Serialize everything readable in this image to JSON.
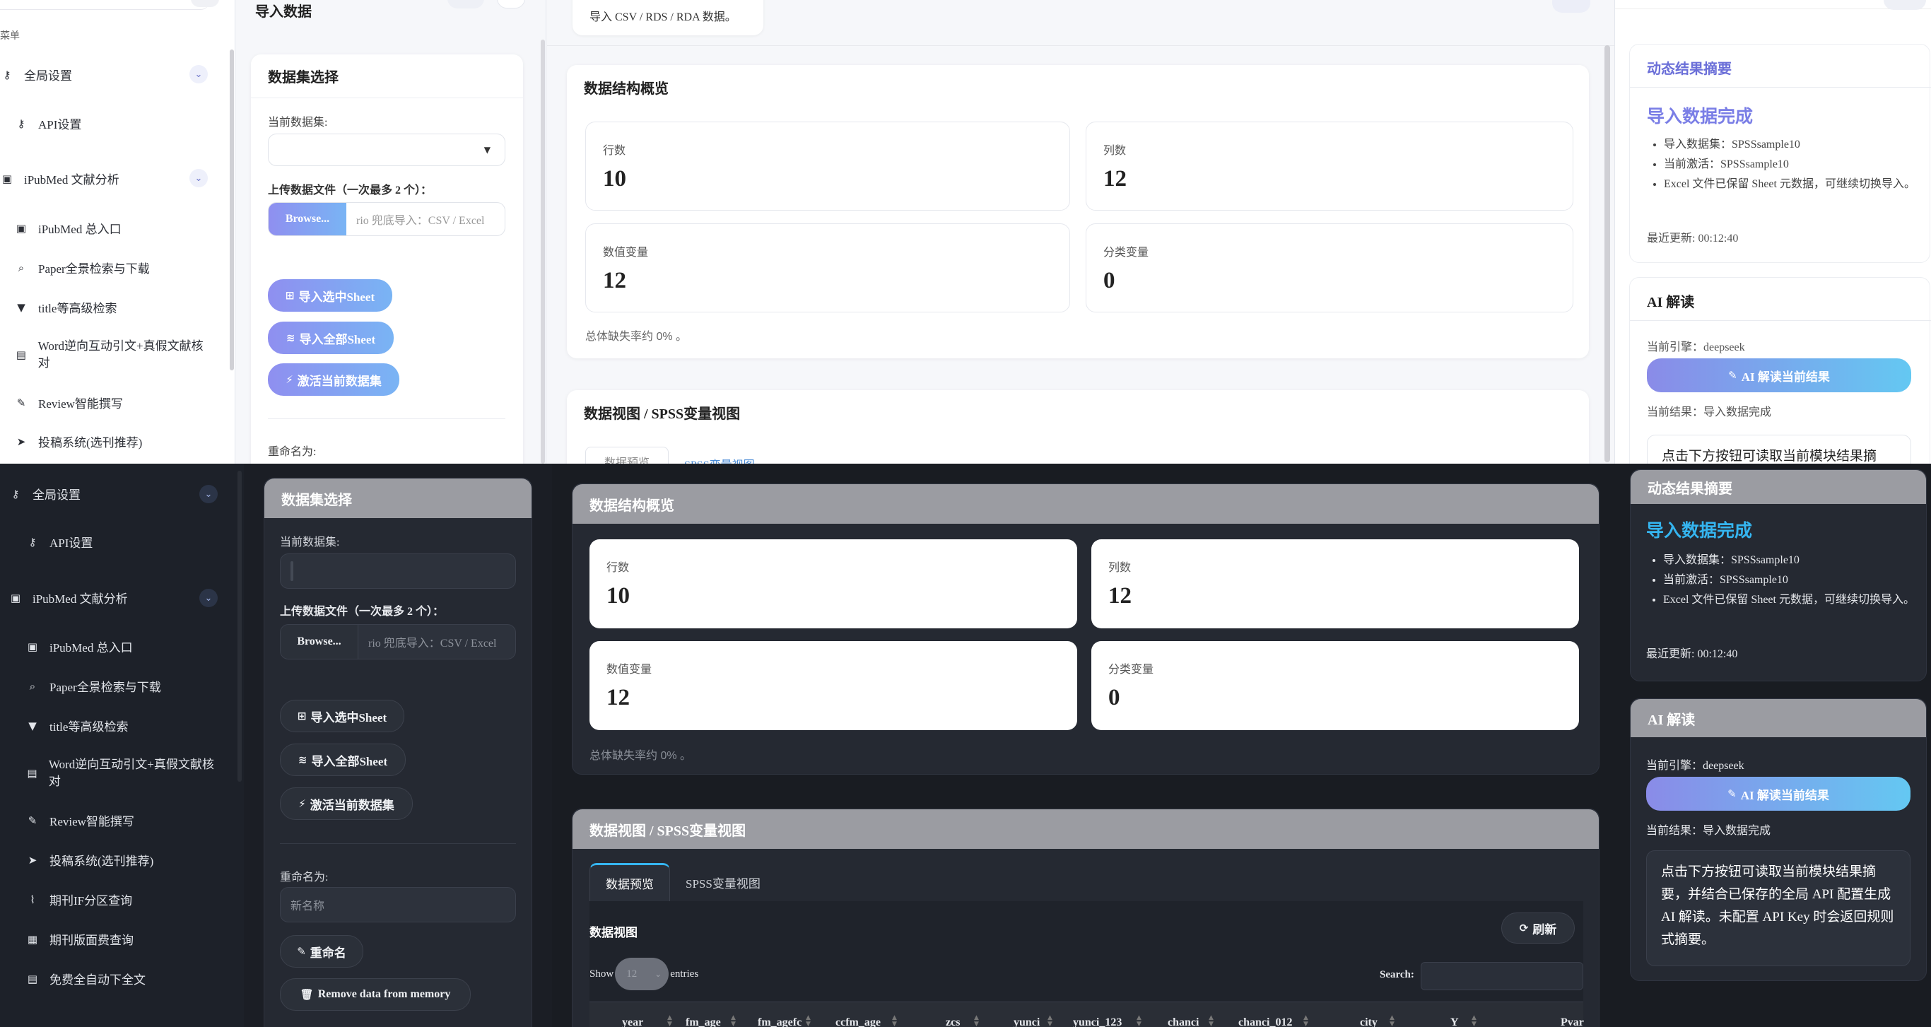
{
  "sidebar": {
    "top_label": "菜单",
    "global_settings": "全局设置",
    "api_settings": "API设置",
    "ipubmed": "iPubMed 文献分析",
    "items": [
      "iPubMed 总入口",
      "Paper全景检索与下载",
      "title等高级检索",
      "Word逆向互动引文+真假文献核对",
      "Review智能撰写",
      "投稿系统(选刊推荐)",
      "期刊IF分区查询",
      "期刊版面费查询",
      "免费全自动下全文"
    ],
    "icons": {
      "key": "key-icon",
      "book": "book-icon",
      "search": "search-icon",
      "filter": "filter-icon",
      "doc": "file-icon",
      "pen": "pen-icon",
      "plane": "paper-plane-icon",
      "chart": "chart-line-icon",
      "news": "newspaper-icon",
      "pdf": "file-pdf-icon"
    }
  },
  "page": {
    "title": "导入数据",
    "import_hint": "导入 CSV / RDS / RDA 数据。"
  },
  "dataset": {
    "title": "数据集选择",
    "current_label": "当前数据集:",
    "upload_label": "上传数据文件（一次最多 2 个）：",
    "browse": "Browse...",
    "file_placeholder": "rio 兜底导入：CSV / Excel",
    "btn_import_sheet": "导入选中Sheet",
    "btn_import_all": "导入全部Sheet",
    "btn_activate": "激活当前数据集",
    "rename_label": "重命名为:",
    "rename_placeholder": "新名称",
    "btn_rename": "重命名",
    "btn_remove": "Remove data from memory"
  },
  "overview": {
    "title": "数据结构概览",
    "stats": [
      {
        "label": "行数",
        "value": "10"
      },
      {
        "label": "列数",
        "value": "12"
      },
      {
        "label": "数值变量",
        "value": "12"
      },
      {
        "label": "分类变量",
        "value": "0"
      }
    ],
    "missing": "总体缺失率约 0% 。"
  },
  "view": {
    "title": "数据视图 / SPSS变量视图",
    "tabs": [
      "数据预览",
      "SPSS变量视图"
    ],
    "subtitle": "数据视图",
    "refresh": "刷新",
    "show": "Show",
    "entries_value": "12",
    "entries": "entries",
    "search": "Search:",
    "columns": [
      "year",
      "fm_age",
      "fm_agefc",
      "ccfm_age",
      "zcs",
      "yunci",
      "yunci_123",
      "chanci",
      "chanci_012",
      "city",
      "Y",
      "Pvar"
    ]
  },
  "summary": {
    "title": "动态结果摘要",
    "headline": "导入数据完成",
    "items": [
      "导入数据集：SPSSsample10",
      "当前激活：SPSSsample10",
      "Excel 文件已保留 Sheet 元数据，可继续切换导入。"
    ],
    "updated": "最近更新: 00:12:40"
  },
  "ai": {
    "title": "AI 解读",
    "engine": "当前引擎：deepseek",
    "button": "AI 解读当前结果",
    "result": "当前结果：导入数据完成",
    "hint": "点击下方按钮可读取当前模块结果摘要，并结合已保存的全局 API 配置生成 AI 解读。未配置 API Key 时会返回规则式摘要。"
  },
  "colors": {
    "accent": "#7a7ee6",
    "dark_bg": "#191c22",
    "cyan": "#35b5f0"
  }
}
